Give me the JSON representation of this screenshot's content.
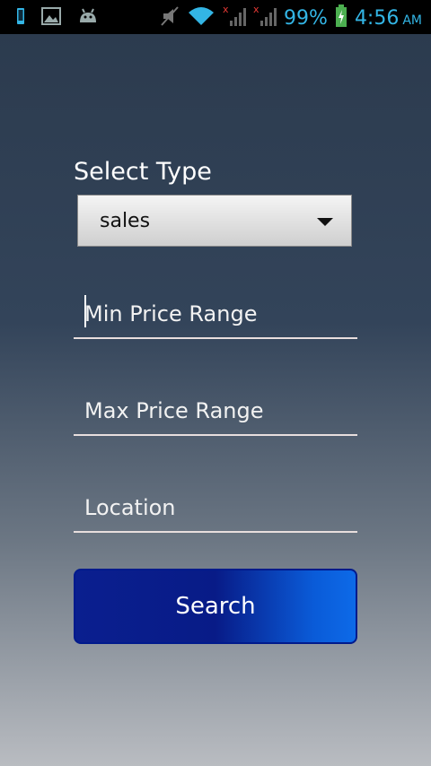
{
  "status_bar": {
    "battery_percent": "99%",
    "time": "4:56",
    "ampm": "AM",
    "icons": [
      "phone-icon",
      "image-icon",
      "android-icon",
      "mute-icon",
      "wifi-icon",
      "signal-1-icon",
      "signal-2-icon",
      "battery-charging-icon"
    ],
    "accent_color": "#33b5e5"
  },
  "form": {
    "select_type_label": "Select Type",
    "select_type_value": "sales",
    "min_price_placeholder": "Min Price Range",
    "max_price_placeholder": "Max Price Range",
    "location_placeholder": "Location",
    "search_label": "Search"
  }
}
